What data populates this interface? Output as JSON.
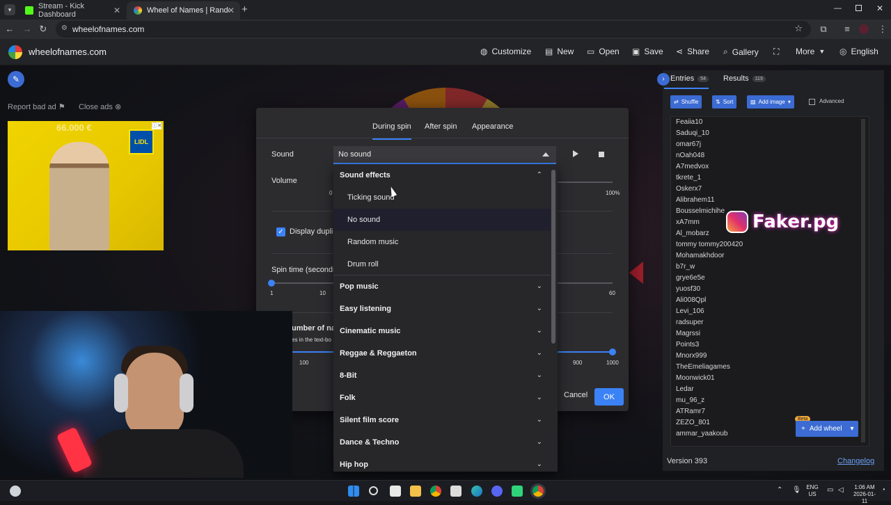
{
  "browser": {
    "tabs": [
      {
        "title": "Stream - Kick Dashboard",
        "active": false
      },
      {
        "title": "Wheel of Names | Random nam",
        "active": true
      }
    ],
    "url": "wheelofnames.com"
  },
  "nav": {
    "brand": "wheelofnames.com",
    "items": [
      "Customize",
      "New",
      "Open",
      "Save",
      "Share",
      "Gallery",
      "More",
      "English"
    ]
  },
  "left": {
    "report_ad": "Report bad ad",
    "close_ads": "Close ads",
    "ad_price": "66.000 €"
  },
  "dialog": {
    "tabs": [
      "During spin",
      "After spin",
      "Appearance"
    ],
    "sound_label": "Sound",
    "volume_label": "Volume",
    "volume_max": "100%",
    "display_duplicates": "Display dupli",
    "spin_time_label": "Spin time (seconds",
    "spin_ticks": [
      "1",
      "10",
      "60"
    ],
    "max_names_label": "umber of na",
    "max_names_sub": "es in the text-bo",
    "max_ticks": [
      "100",
      "900",
      "1000"
    ],
    "cancel": "Cancel",
    "ok": "OK"
  },
  "sound_select": {
    "value": "No sound",
    "groups": [
      {
        "label": "Sound effects",
        "expanded": true,
        "options": [
          "Ticking sound",
          "No sound",
          "Random music",
          "Drum roll"
        ],
        "selected": "No sound"
      },
      {
        "label": "Pop music",
        "expanded": false
      },
      {
        "label": "Easy listening",
        "expanded": false
      },
      {
        "label": "Cinematic music",
        "expanded": false
      },
      {
        "label": "Reggae & Reggaeton",
        "expanded": false
      },
      {
        "label": "8-Bit",
        "expanded": false
      },
      {
        "label": "Folk",
        "expanded": false
      },
      {
        "label": "Silent film score",
        "expanded": false
      },
      {
        "label": "Dance & Techno",
        "expanded": false
      },
      {
        "label": "Hip hop",
        "expanded": false
      }
    ]
  },
  "panel": {
    "tabs": [
      {
        "label": "Entries",
        "count": "54"
      },
      {
        "label": "Results",
        "count": "119"
      }
    ],
    "buttons": [
      "Shuffle",
      "Sort",
      "Add image"
    ],
    "advanced": "Advanced",
    "entries": [
      "Feaiia10",
      "Saduqi_10",
      "omar67j",
      "nOah048",
      "A7medvox",
      "tkrete_1",
      "Oskerx7",
      "Alibrahem11",
      "Bousselmichihe",
      "xA7mm",
      "Al_mobarz",
      "tommy tommy200420",
      "Mohamakhdoor",
      "b7r_w",
      "grye6e5e",
      "yuosf30",
      "Ali008Qpl",
      "Levi_106",
      "radsuper",
      "Magrssi",
      "Points3",
      "Mnorx999",
      "TheEmeliagames",
      "Moonwick01",
      "Ledar",
      "mu_96_z",
      "ATRamr7",
      "ZEZO_801",
      "ammar_yaakoub"
    ],
    "add_wheel": "Add wheel",
    "beta": "Beta",
    "version": "Version 393",
    "changelog": "Changelog"
  },
  "overlay": {
    "handle": "Faker.pg"
  },
  "taskbar": {
    "lang_top": "ENG",
    "lang_bottom": "US",
    "time": "1:06 AM",
    "date": "2026-01-11"
  },
  "colors": {
    "accent": "#3b82f6",
    "nav_bg": "#232427",
    "dialog_bg": "#2c2c2f"
  }
}
